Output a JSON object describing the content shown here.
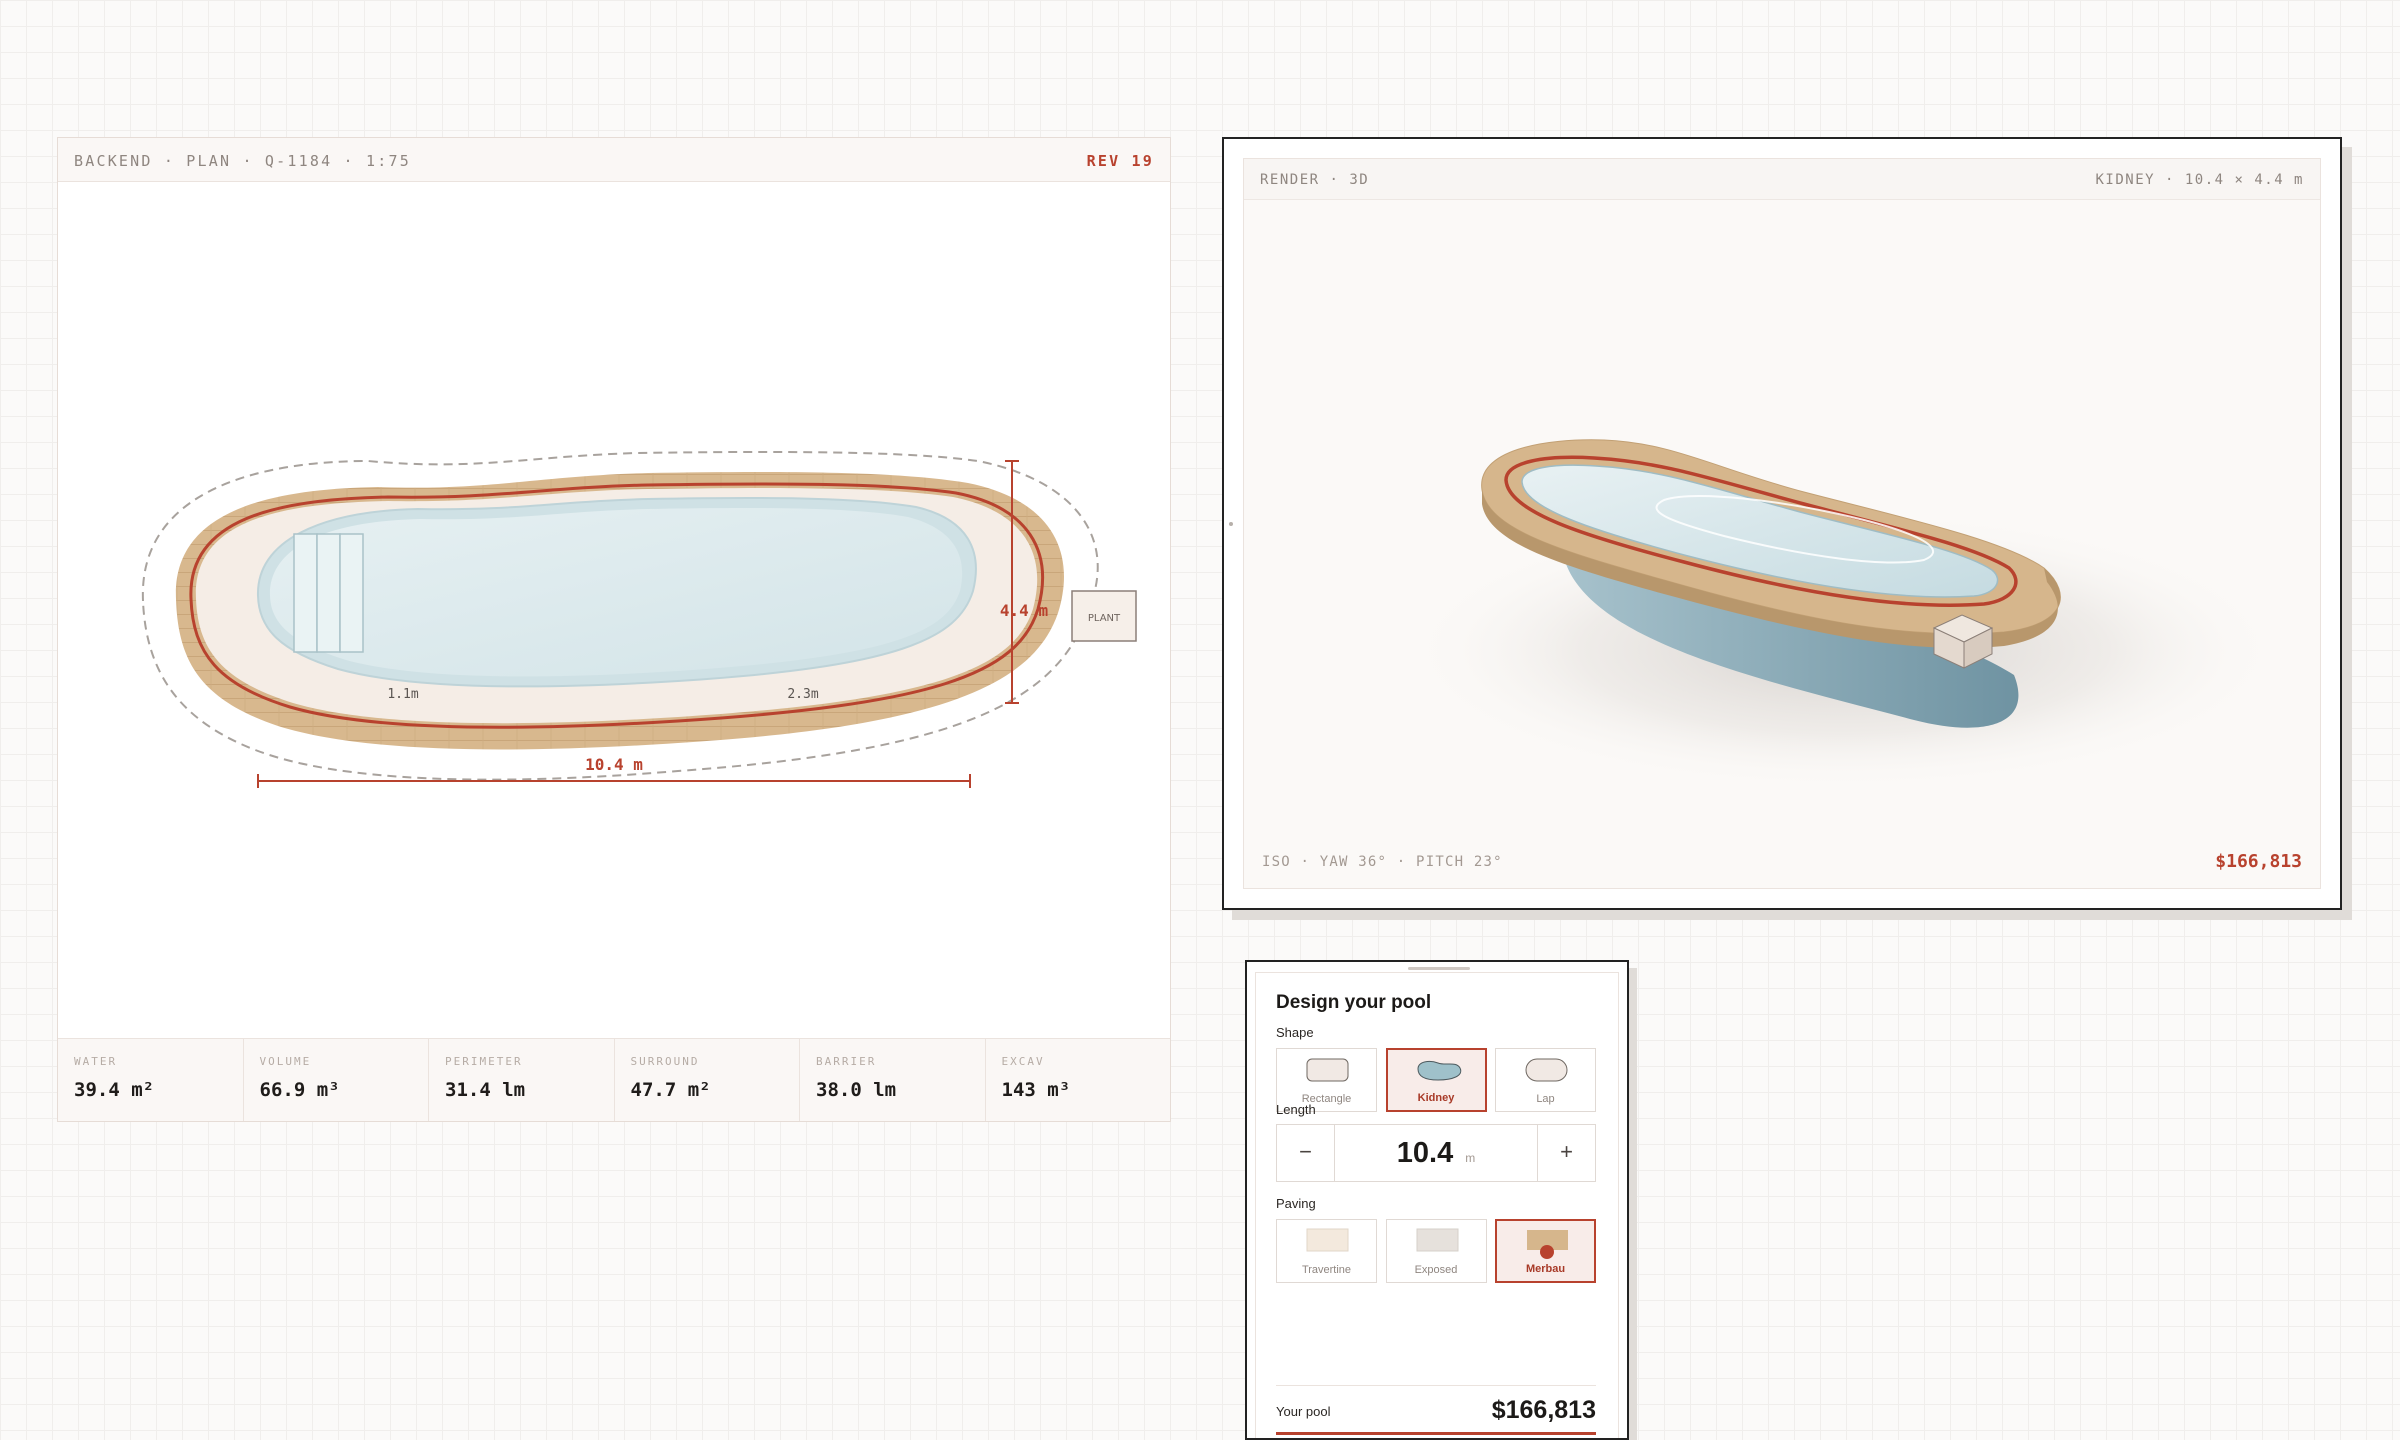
{
  "plan": {
    "header_left": "BACKEND · PLAN · Q-1184 · 1:75",
    "header_right": "REV 19",
    "plant_label": "PLANT",
    "depth_shallow": "1.1m",
    "depth_deep": "2.3m",
    "width_dim": "4.4 m",
    "length_dim": "10.4 m",
    "stats": [
      {
        "label": "WATER",
        "value": "39.4 m²"
      },
      {
        "label": "VOLUME",
        "value": "66.9 m³"
      },
      {
        "label": "PERIMETER",
        "value": "31.4 lm"
      },
      {
        "label": "SURROUND",
        "value": "47.7 m²"
      },
      {
        "label": "BARRIER",
        "value": "38.0 lm"
      },
      {
        "label": "EXCAV",
        "value": "143 m³"
      }
    ]
  },
  "render": {
    "header_left": "RENDER · 3D",
    "header_right": "KIDNEY · 10.4 × 4.4 m",
    "footer_left": "ISO · YAW 36° · PITCH 23°",
    "footer_price": "$166,813"
  },
  "design": {
    "title": "Design your pool",
    "shape_label": "Shape",
    "shapes": [
      {
        "label": "Rectangle",
        "selected": false
      },
      {
        "label": "Kidney",
        "selected": true
      },
      {
        "label": "Lap",
        "selected": false
      }
    ],
    "length_label": "Length",
    "length_value": "10.4",
    "length_unit": "m",
    "minus": "−",
    "plus": "+",
    "paving_label": "Paving",
    "pavings": [
      {
        "label": "Travertine",
        "selected": false
      },
      {
        "label": "Exposed",
        "selected": false
      },
      {
        "label": "Merbau",
        "selected": true
      }
    ],
    "total_label": "Your pool",
    "total_value": "$166,813"
  },
  "colors": {
    "accent": "#b8422e",
    "water": "#dbe9ec",
    "deck": "#d6b68c",
    "coping": "#f5ede7",
    "render_water": "#7fa0ae"
  }
}
